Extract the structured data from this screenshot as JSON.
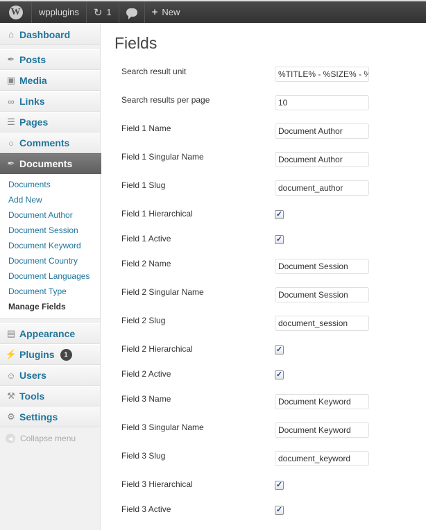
{
  "admin_bar": {
    "site_name": "wpplugins",
    "updates_count": "1",
    "new_label": "New"
  },
  "sidebar": {
    "items": [
      {
        "label": "Dashboard",
        "icon": "home-icon"
      },
      {
        "label": "Posts",
        "icon": "pin-icon"
      },
      {
        "label": "Media",
        "icon": "media-icon"
      },
      {
        "label": "Links",
        "icon": "link-icon"
      },
      {
        "label": "Pages",
        "icon": "pages-icon"
      },
      {
        "label": "Comments",
        "icon": "comment-icon"
      },
      {
        "label": "Documents",
        "icon": "pin-icon"
      }
    ],
    "submenu": [
      "Documents",
      "Add New",
      "Document Author",
      "Document Session",
      "Document Keyword",
      "Document Country",
      "Document Languages",
      "Document Type",
      "Manage Fields"
    ],
    "lower_items": [
      {
        "label": "Appearance",
        "icon": "appearance-icon"
      },
      {
        "label": "Plugins",
        "icon": "plugin-icon",
        "badge": "1"
      },
      {
        "label": "Users",
        "icon": "users-icon"
      },
      {
        "label": "Tools",
        "icon": "tools-icon"
      },
      {
        "label": "Settings",
        "icon": "settings-icon"
      }
    ],
    "collapse_label": "Collapse menu"
  },
  "main": {
    "title": "Fields",
    "rows": [
      {
        "label": "Search result unit",
        "type": "text",
        "value": "%TITLE% - %SIZE% - %"
      },
      {
        "label": "Search results per page",
        "type": "text",
        "value": "10"
      },
      {
        "label": "Field 1 Name",
        "type": "text",
        "value": "Document Author"
      },
      {
        "label": "Field 1 Singular Name",
        "type": "text",
        "value": "Document Author"
      },
      {
        "label": "Field 1 Slug",
        "type": "text",
        "value": "document_author"
      },
      {
        "label": "Field 1 Hierarchical",
        "type": "checkbox",
        "checked": true
      },
      {
        "label": "Field 1 Active",
        "type": "checkbox",
        "checked": true
      },
      {
        "label": "Field 2 Name",
        "type": "text",
        "value": "Document Session"
      },
      {
        "label": "Field 2 Singular Name",
        "type": "text",
        "value": "Document Session"
      },
      {
        "label": "Field 2 Slug",
        "type": "text",
        "value": "document_session"
      },
      {
        "label": "Field 2 Hierarchical",
        "type": "checkbox",
        "checked": true
      },
      {
        "label": "Field 2 Active",
        "type": "checkbox",
        "checked": true
      },
      {
        "label": "Field 3 Name",
        "type": "text",
        "value": "Document Keyword"
      },
      {
        "label": "Field 3 Singular Name",
        "type": "text",
        "value": "Document Keyword"
      },
      {
        "label": "Field 3 Slug",
        "type": "text",
        "value": "document_keyword"
      },
      {
        "label": "Field 3 Hierarchical",
        "type": "checkbox",
        "checked": true
      },
      {
        "label": "Field 3 Active",
        "type": "checkbox",
        "checked": true
      }
    ]
  }
}
